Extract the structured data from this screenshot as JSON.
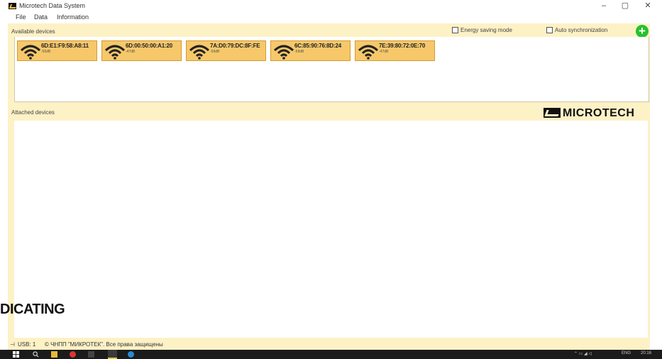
{
  "window": {
    "title": "Microtech Data System",
    "controls": {
      "minimize": "–",
      "restore": "▢",
      "close": "✕"
    }
  },
  "menu": {
    "items": [
      "File",
      "Data",
      "Information"
    ]
  },
  "available": {
    "label": "Available devices",
    "energy_label": "Energy saving mode",
    "energy_checked": false,
    "autosync_label": "Auto synchronization",
    "autosync_checked": false,
    "add_icon": "plus-circle-icon",
    "devices": [
      {
        "mac": "6D:E1:F9:58:A8:11",
        "signal": "-55dB"
      },
      {
        "mac": "6D:00:50:00:A1:20",
        "signal": "-47dB"
      },
      {
        "mac": "7A:D0:79:DC:8F:FE",
        "signal": "-59dB"
      },
      {
        "mac": "6C:85:90:76:8D:24",
        "signal": "-59dB"
      },
      {
        "mac": "7E:39:80:72:0E:70",
        "signal": "-47dB"
      }
    ]
  },
  "attached": {
    "label": "Attached devices"
  },
  "brand": {
    "logo_text": "MICROTECH"
  },
  "overlay": {
    "text": "DICATING"
  },
  "status": {
    "usb": "USB: 1",
    "copyright": "© ЧНПП \"МИКРОТЕК\". Все права защищены"
  },
  "taskbar": {
    "lang": "ENG",
    "time": "20:16"
  },
  "colors": {
    "panel_bg": "#fdf1c6",
    "card_bg": "#f6c86a",
    "add_button": "#26c12e"
  }
}
